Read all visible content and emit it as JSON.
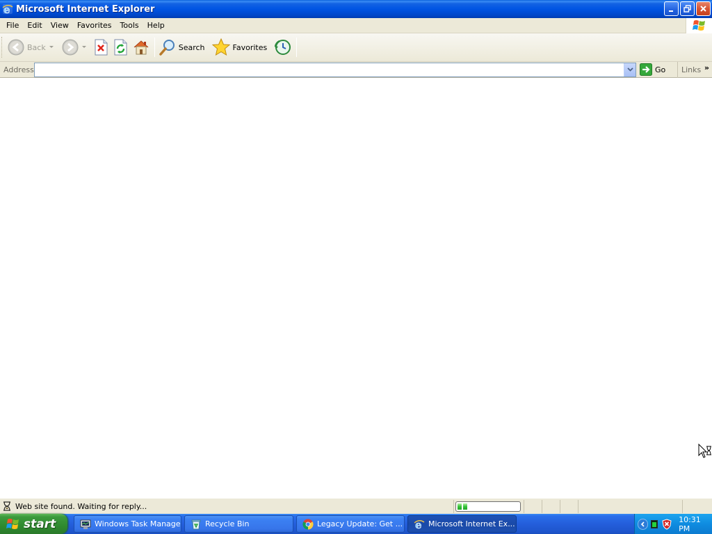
{
  "window": {
    "title": "Microsoft Internet Explorer",
    "icon": "ie-icon",
    "controls": [
      "minimize-icon",
      "restore-icon",
      "close-icon"
    ]
  },
  "menubar": {
    "items": [
      "File",
      "Edit",
      "View",
      "Favorites",
      "Tools",
      "Help"
    ]
  },
  "toolbar": {
    "back_label": "Back",
    "back_enabled": false,
    "search_label": "Search",
    "favorites_label": "Favorites",
    "buttons": [
      "back-icon",
      "forward-icon",
      "stop-icon",
      "refresh-icon",
      "home-icon",
      "search-icon",
      "favorites-icon",
      "history-icon"
    ]
  },
  "address": {
    "label": "Address",
    "value": "",
    "go_label": "Go",
    "links_label": "Links"
  },
  "status": {
    "text": "Web site found. Waiting for reply...",
    "progress_percent": 15
  },
  "taskbar": {
    "start_label": "start",
    "tasks": [
      {
        "label": "Windows Task Manager",
        "icon": "task-manager-icon",
        "active": false
      },
      {
        "label": "Recycle Bin",
        "icon": "recycle-bin-icon",
        "active": false
      },
      {
        "label": "Legacy Update: Get ...",
        "icon": "chrome-icon",
        "active": false
      },
      {
        "label": "Microsoft Internet Ex...",
        "icon": "ie-icon",
        "active": true
      }
    ],
    "clock": "10:31 PM",
    "tray_icons": [
      "show-hidden-icons-icon",
      "task-manager-tray-icon",
      "security-shield-icon"
    ]
  },
  "colors": {
    "title_blue": "#0054e3",
    "chrome_beige": "#ece9d8",
    "start_green": "#3c9a3c",
    "taskbar_blue": "#245edb",
    "tray_blue": "#0f8ce0"
  }
}
